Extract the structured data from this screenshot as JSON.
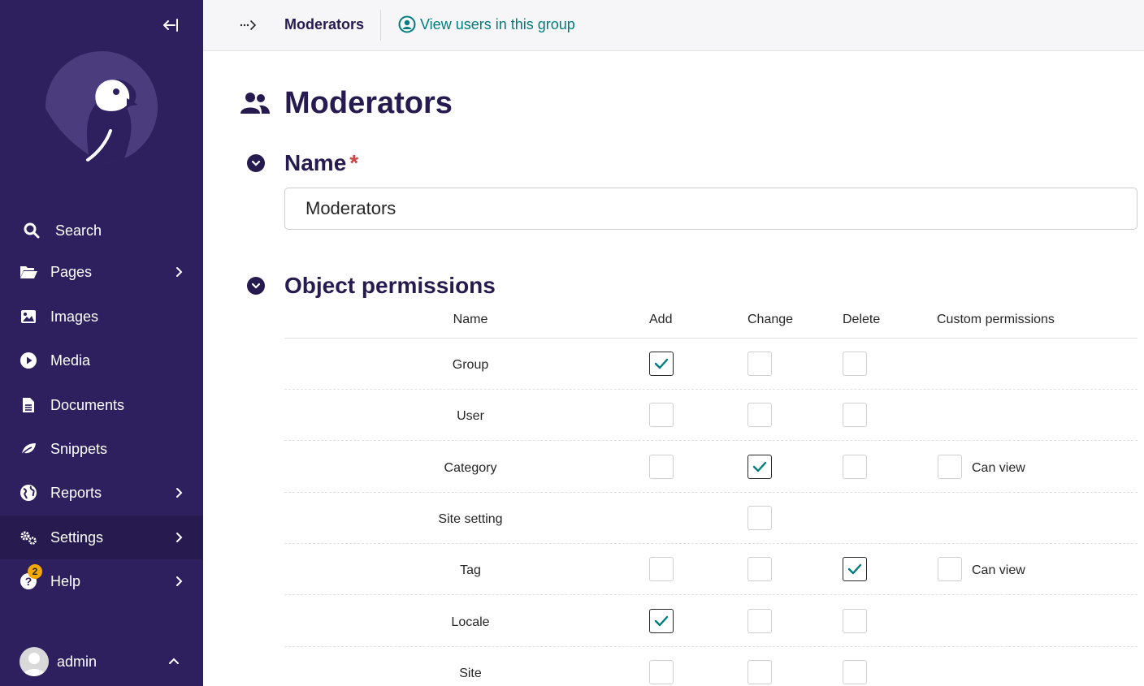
{
  "sidebar": {
    "items": [
      {
        "label": "Search",
        "icon": "search-icon"
      },
      {
        "label": "Pages",
        "icon": "folder-open-icon"
      },
      {
        "label": "Images",
        "icon": "image-icon"
      },
      {
        "label": "Media",
        "icon": "play-circle-icon"
      },
      {
        "label": "Documents",
        "icon": "document-icon"
      },
      {
        "label": "Snippets",
        "icon": "snippet-icon"
      },
      {
        "label": "Reports",
        "icon": "globe-icon"
      },
      {
        "label": "Settings",
        "icon": "cogs-icon"
      },
      {
        "label": "Help",
        "icon": "help-icon",
        "badge": "2"
      }
    ],
    "user": {
      "name": "admin"
    }
  },
  "header": {
    "title": "Moderators",
    "view_users_link": "View users in this group"
  },
  "main": {
    "page_title": "Moderators",
    "name_section": {
      "title": "Name",
      "required_mark": "*",
      "value": "Moderators"
    },
    "permissions_section": {
      "title": "Object permissions",
      "columns": [
        "Name",
        "Add",
        "Change",
        "Delete",
        "Custom permissions"
      ],
      "rows": [
        {
          "name": "Group",
          "add": true,
          "change": false,
          "delete": false
        },
        {
          "name": "User",
          "add": false,
          "change": false,
          "delete": false
        },
        {
          "name": "Category",
          "add": false,
          "change": true,
          "delete": false,
          "custom_label": "Can view",
          "custom": false
        },
        {
          "name": "Site setting",
          "change": false
        },
        {
          "name": "Tag",
          "add": false,
          "change": false,
          "delete": true,
          "custom_label": "Can view",
          "custom": false
        },
        {
          "name": "Locale",
          "add": true,
          "change": false,
          "delete": false
        },
        {
          "name": "Site",
          "add": false,
          "change": false,
          "delete": false
        }
      ]
    }
  },
  "colors": {
    "sidebar_bg": "#2e1f5e",
    "accent": "#007d7e",
    "title": "#261a4f",
    "badge": "#f7a800",
    "required": "#cd4444"
  }
}
